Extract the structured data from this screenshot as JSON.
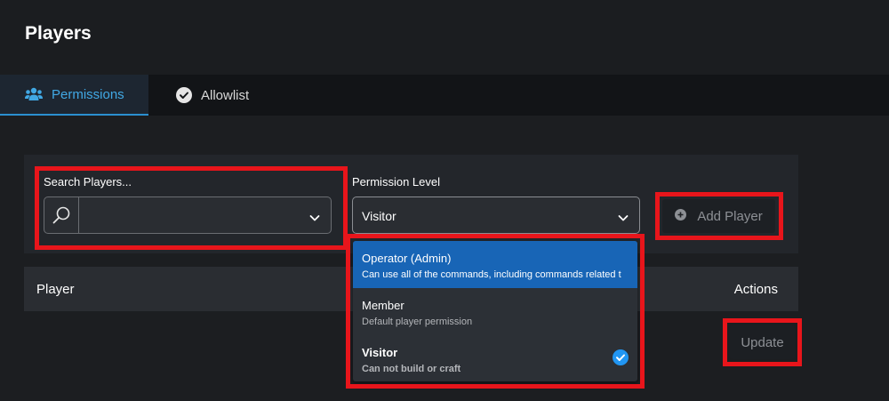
{
  "page": {
    "title": "Players"
  },
  "tabs": [
    {
      "label": "Permissions",
      "icon": "users-icon",
      "active": true
    },
    {
      "label": "Allowlist",
      "icon": "check-circle-icon",
      "active": false
    }
  ],
  "search": {
    "label": "Search Players...",
    "value": ""
  },
  "permission": {
    "label": "Permission Level",
    "selected": "Visitor",
    "options": [
      {
        "title": "Operator (Admin)",
        "description": "Can use all of the commands, including commands related t",
        "highlighted": true
      },
      {
        "title": "Member",
        "description": "Default player permission",
        "highlighted": false
      },
      {
        "title": "Visitor",
        "description": "Can not build or craft",
        "selected": true
      }
    ]
  },
  "add_player": {
    "label": "Add Player",
    "icon": "plus-circle-icon"
  },
  "table": {
    "columns": [
      "Player",
      "Actions"
    ]
  },
  "update": {
    "label": "Update"
  },
  "colors": {
    "accent": "#41a8e4",
    "highlight_option": "#1865b6",
    "annotation_box": "#e8151b",
    "check": "#2196f3"
  }
}
